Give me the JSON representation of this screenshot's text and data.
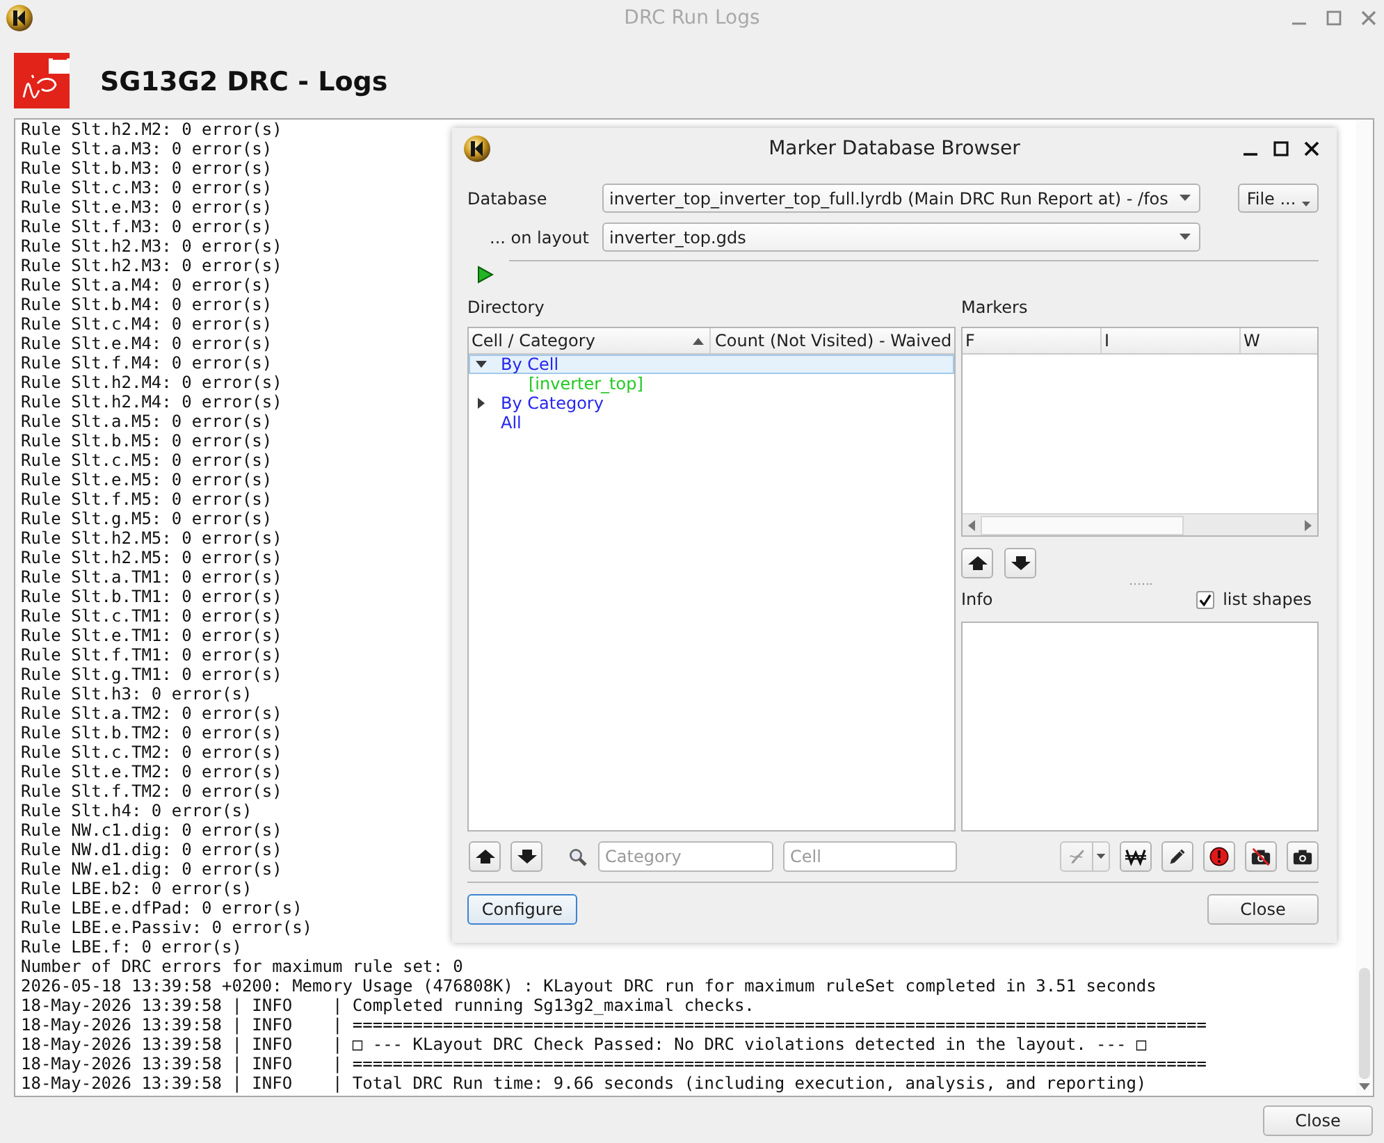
{
  "window": {
    "title": "DRC Run Logs",
    "active": false
  },
  "header": {
    "title": "SG13G2 DRC - Logs"
  },
  "log": {
    "lines": [
      "Rule Slt.h2.M2: 0 error(s)",
      "Rule Slt.a.M3: 0 error(s)",
      "Rule Slt.b.M3: 0 error(s)",
      "Rule Slt.c.M3: 0 error(s)",
      "Rule Slt.e.M3: 0 error(s)",
      "Rule Slt.f.M3: 0 error(s)",
      "Rule Slt.h2.M3: 0 error(s)",
      "Rule Slt.h2.M3: 0 error(s)",
      "Rule Slt.a.M4: 0 error(s)",
      "Rule Slt.b.M4: 0 error(s)",
      "Rule Slt.c.M4: 0 error(s)",
      "Rule Slt.e.M4: 0 error(s)",
      "Rule Slt.f.M4: 0 error(s)",
      "Rule Slt.h2.M4: 0 error(s)",
      "Rule Slt.h2.M4: 0 error(s)",
      "Rule Slt.a.M5: 0 error(s)",
      "Rule Slt.b.M5: 0 error(s)",
      "Rule Slt.c.M5: 0 error(s)",
      "Rule Slt.e.M5: 0 error(s)",
      "Rule Slt.f.M5: 0 error(s)",
      "Rule Slt.g.M5: 0 error(s)",
      "Rule Slt.h2.M5: 0 error(s)",
      "Rule Slt.h2.M5: 0 error(s)",
      "Rule Slt.a.TM1: 0 error(s)",
      "Rule Slt.b.TM1: 0 error(s)",
      "Rule Slt.c.TM1: 0 error(s)",
      "Rule Slt.e.TM1: 0 error(s)",
      "Rule Slt.f.TM1: 0 error(s)",
      "Rule Slt.g.TM1: 0 error(s)",
      "Rule Slt.h3: 0 error(s)",
      "Rule Slt.a.TM2: 0 error(s)",
      "Rule Slt.b.TM2: 0 error(s)",
      "Rule Slt.c.TM2: 0 error(s)",
      "Rule Slt.e.TM2: 0 error(s)",
      "Rule Slt.f.TM2: 0 error(s)",
      "Rule Slt.h4: 0 error(s)",
      "Rule NW.c1.dig: 0 error(s)",
      "Rule NW.d1.dig: 0 error(s)",
      "Rule NW.e1.dig: 0 error(s)",
      "Rule LBE.b2: 0 error(s)",
      "Rule LBE.e.dfPad: 0 error(s)",
      "Rule LBE.e.Passiv: 0 error(s)",
      "Rule LBE.f: 0 error(s)",
      "Number of DRC errors for maximum rule set: 0",
      "2026-05-18 13:39:58 +0200: Memory Usage (476808K) : KLayout DRC run for maximum ruleSet completed in 3.51 seconds",
      "18-May-2026 13:39:58 | INFO    | Completed running Sg13g2_maximal checks.",
      "18-May-2026 13:39:58 | INFO    | =====================================================================================",
      "18-May-2026 13:39:58 | INFO    | □ --- KLayout DRC Check Passed: No DRC violations detected in the layout. --- □",
      "18-May-2026 13:39:58 | INFO    | =====================================================================================",
      "18-May-2026 13:39:58 | INFO    | Total DRC Run time: 9.66 seconds (including execution, analysis, and reporting)"
    ]
  },
  "footer": {
    "close_button": "Close"
  },
  "marker_browser": {
    "title": "Marker Database Browser",
    "database": {
      "label": "Database",
      "value": "inverter_top_inverter_top_full.lyrdb (Main DRC Run Report at) - /fos"
    },
    "layout": {
      "label": "... on layout",
      "value": "inverter_top.gds"
    },
    "file_button": "File ...",
    "directory": {
      "label": "Directory",
      "columns": [
        {
          "label": "Cell / Category",
          "sorted": true
        },
        {
          "label": "Count (Not Visited) - Waived",
          "sorted": false
        }
      ],
      "items": [
        {
          "label": "By Cell",
          "kind": "group",
          "expanded": true,
          "selected": true,
          "children": [
            {
              "label": "[inverter_top]",
              "kind": "cell",
              "selected": false
            }
          ]
        },
        {
          "label": "By Category",
          "kind": "group",
          "expanded": false,
          "selected": false
        },
        {
          "label": "All",
          "kind": "group",
          "selected": false
        }
      ]
    },
    "markers": {
      "label": "Markers",
      "columns": [
        "F",
        "I",
        "W"
      ]
    },
    "info": {
      "label": "Info",
      "list_shapes": {
        "label": "list shapes",
        "checked": true
      }
    },
    "filters": [
      {
        "placeholder": "Category"
      },
      {
        "placeholder": "Cell"
      }
    ],
    "tools": [
      {
        "kind": "flag",
        "disabled": true
      },
      {
        "kind": "waive",
        "disabled": false
      },
      {
        "kind": "edit",
        "disabled": false
      },
      {
        "kind": "important",
        "disabled": false
      },
      {
        "kind": "nosnapshot",
        "disabled": false
      },
      {
        "kind": "snapshot",
        "disabled": false
      }
    ],
    "configure_button": {
      "label": "Configure",
      "focused": true
    },
    "close_button": {
      "label": "Close",
      "focused": false
    }
  }
}
